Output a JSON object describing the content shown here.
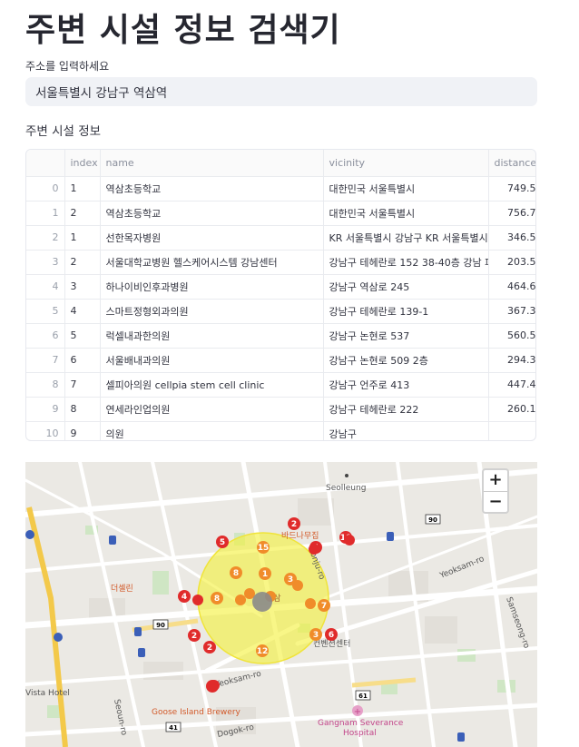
{
  "title": "주변 시설 정보 검색기",
  "address_input": {
    "label": "주소를 입력하세요",
    "value": "서울특별시 강남구 역삼역"
  },
  "section_title": "주변 시설 정보",
  "table": {
    "columns": [
      "",
      "index",
      "name",
      "vicinity",
      "distance"
    ],
    "rows": [
      [
        "0",
        "1",
        "역삼초등학교",
        "대한민국 서울특별시",
        "749.54"
      ],
      [
        "1",
        "2",
        "역삼초등학교",
        "대한민국 서울특별시",
        "756.76"
      ],
      [
        "2",
        "1",
        "선한목자병원",
        "KR 서울특별시 강남구 KR 서울특별시",
        "346.55"
      ],
      [
        "3",
        "2",
        "서울대학교병원 헬스케어시스템 강남센터",
        "강남구 테헤란로 152 38-40층 강남 파",
        "203.55"
      ],
      [
        "4",
        "3",
        "하나이비인후과병원",
        "강남구 역삼로 245",
        "464.62"
      ],
      [
        "5",
        "4",
        "스마트정형외과의원",
        "강남구 테헤란로 139-1",
        "367.39"
      ],
      [
        "6",
        "5",
        "럭셀내과한의원",
        "강남구 논현로 537",
        "560.55"
      ],
      [
        "7",
        "6",
        "서울배내과의원",
        "강남구 논현로 509 2층",
        "294.32"
      ],
      [
        "8",
        "7",
        "셀피아의원 cellpia stem cell clinic",
        "강남구 언주로 413",
        "447.46"
      ],
      [
        "9",
        "8",
        "연세라인업의원",
        "강남구 테헤란로 222",
        "260.13"
      ],
      [
        "10",
        "9",
        "의원",
        "강남구",
        ""
      ]
    ]
  },
  "map": {
    "zoom_in": "+",
    "zoom_out": "−",
    "labels": {
      "seolleung": "Seolleung",
      "badanamu": "바드나무집",
      "deseollin": "더셀린",
      "yeoksam_ro_right": "Yeoksam-ro",
      "samseong_ro": "Samseong-ro",
      "yeoksam_ro_low": "Yeoksam-ro",
      "seoun_ro": "Seoun-ro",
      "vista_hotel": "Vista Hotel",
      "goose_island": "Goose Island Brewery",
      "dogok_ro": "Dogok-ro",
      "gangnam_severance": "Gangnam Severance",
      "hospital": "Hospital",
      "eonju_ro": "Eonju-ro",
      "conference_center": "컨벤션센터",
      "yeoksam_station": "역삼"
    },
    "road_shields": [
      "90",
      "90",
      "61",
      "41"
    ],
    "markers": [
      "2",
      "5",
      "15",
      "10",
      "4",
      "8",
      "1",
      "3",
      "4",
      "2",
      "2",
      "6",
      "3",
      "12",
      "7",
      "8",
      "2"
    ],
    "colors": {
      "circle_fill": "#f4f03e",
      "marker_red": "#e02b2b",
      "marker_orange": "#f08c2a",
      "center_gray": "#8a8a8a"
    }
  }
}
